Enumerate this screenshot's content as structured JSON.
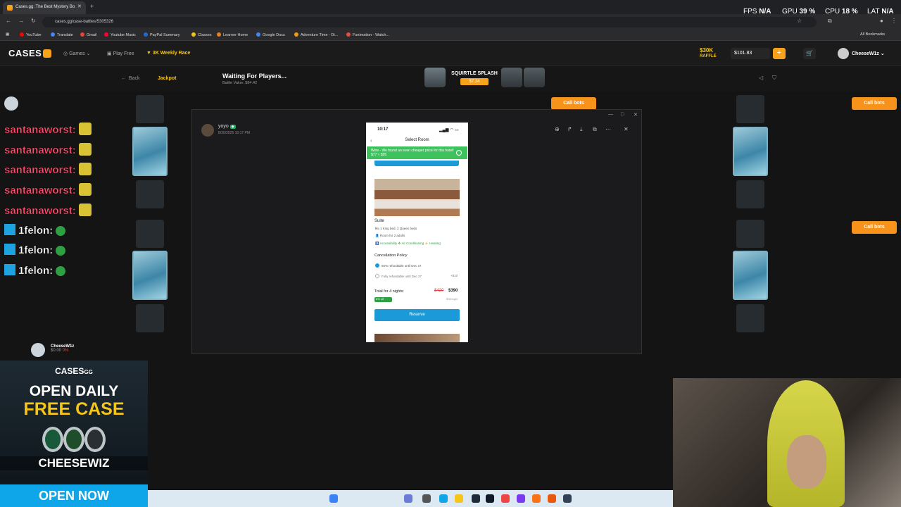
{
  "browser": {
    "tab_title": "Cases.gg: The Best Mystery Bo",
    "url": "cases.gg/case-battles/5305326",
    "bookmarks": [
      {
        "label": "YouTube",
        "color": "#ff0000"
      },
      {
        "label": "Translate",
        "color": "#4285f4"
      },
      {
        "label": "Gmail",
        "color": "#ea4335"
      },
      {
        "label": "Youtube Music",
        "color": "#ff0033"
      },
      {
        "label": "PayPal Summary",
        "color": "#1a6ad8"
      },
      {
        "label": "Classes",
        "color": "#f1c40f"
      },
      {
        "label": "Learner Home",
        "color": "#e67e22"
      },
      {
        "label": "Google Docs",
        "color": "#4285f4"
      },
      {
        "label": "Adventure Time - Di...",
        "color": "#f39c12"
      },
      {
        "label": "Funimation - Watch...",
        "color": "#e74c3c"
      }
    ],
    "all_bookmarks": "All Bookmarks"
  },
  "stats": {
    "fps_label": "FPS",
    "fps": "N/A",
    "gpu_label": "GPU",
    "gpu": "39 %",
    "cpu_label": "CPU",
    "cpu": "18 %",
    "lat_label": "LAT",
    "lat": "N/A"
  },
  "site": {
    "logo": "CASES",
    "nav": {
      "games": "Games",
      "play_free": "Play Free",
      "race": "3K Weekly Race"
    },
    "raffle_top": "$30K",
    "raffle_bottom": "RAFFLE",
    "balance": "$101.83",
    "add": "+",
    "username": "CheeseW1z"
  },
  "battle": {
    "back": "Back",
    "mode": "Jackpot",
    "status": "Waiting For Players...",
    "value": "Battle Value: $84.42",
    "case_name": "SQUIRTLE SPLASH",
    "case_price": "$7.24",
    "call_bots": "Call bots",
    "player_name": "CheeseW1z",
    "player_value": "$0.00",
    "player_pct": "0%"
  },
  "chat": [
    {
      "user": "santanaworst:",
      "style": "red"
    },
    {
      "user": "santanaworst:",
      "style": "red"
    },
    {
      "user": "santanaworst:",
      "style": "red"
    },
    {
      "user": "santanaworst:",
      "style": "red"
    },
    {
      "user": "santanaworst:",
      "style": "red"
    },
    {
      "user": "1felon:",
      "style": "blue"
    },
    {
      "user": "1felon:",
      "style": "blue"
    },
    {
      "user": "1felon:",
      "style": "blue"
    }
  ],
  "ad": {
    "logo": "CASES",
    "logo_sup": "GG",
    "line1": "OPEN DAILY",
    "line2": "FREE CASE",
    "name": "CHEESEWIZ",
    "cta": "OPEN NOW"
  },
  "viewer": {
    "name": "yoyo",
    "date": "8/30/2025 10:17 PM"
  },
  "phone": {
    "time": "10:17",
    "title": "Select Room",
    "banner": "Wow - We found an even cheaper price for this hotel! $77 ≈ $95",
    "room": "Suite",
    "bed": "1 King bed, 2 Queen beds",
    "sleeps": "Room for 2 adults",
    "amenities": "Accessibility  ❖ Air Conditioning  ⚡ Heating",
    "policy": "Cancellation Policy",
    "opt1": "50% refundable until Dec 27",
    "opt2": "Fully refundable until Dec 27",
    "opt2_price": "+$10",
    "total": "Total for 4 nights:",
    "old_price": "$420",
    "new_price": "$390",
    "off": "8% off",
    "per_night": "$98/night",
    "reserve": "Reserve"
  }
}
